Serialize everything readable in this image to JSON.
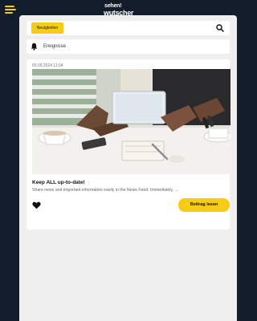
{
  "app": {
    "logo_line1": "sehen!",
    "logo_line2": "wutscher"
  },
  "filter": {
    "category_chip": "Neuigkeiten"
  },
  "events": {
    "label": "Ereignisse"
  },
  "post": {
    "date": "03.09.2024 11:04",
    "title": "Keep ALL up-to-date!",
    "excerpt": "Share news and important information easily in the News Feed. Immediately, ...",
    "read_button": "Beitrag lesen"
  },
  "colors": {
    "accent": "#f7cc14",
    "header_bg": "#121c2a",
    "content_bg": "#efefef"
  },
  "icons": {
    "menu": "hamburger-menu-icon",
    "search": "search-icon",
    "bell": "bell-icon",
    "heart": "heart-icon"
  }
}
